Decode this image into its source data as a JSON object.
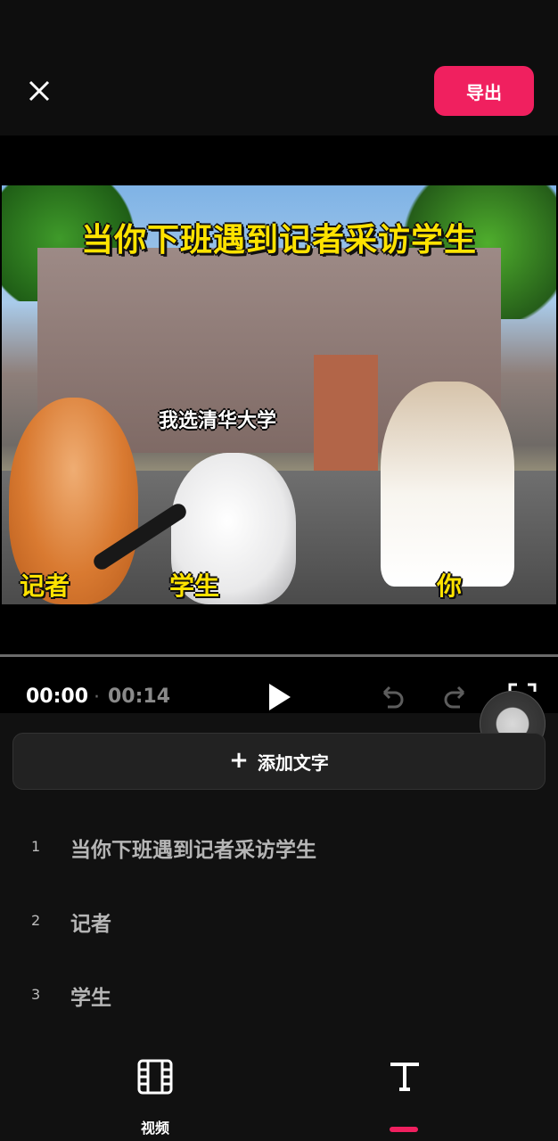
{
  "header": {
    "close_icon": "close-icon",
    "export_label": "导出",
    "accent_color": "#f0205f"
  },
  "preview": {
    "headline": "当你下班遇到记者采访学生",
    "subline": "我选清华大学",
    "labels": {
      "reporter": "记者",
      "student": "学生",
      "you": "你"
    }
  },
  "playback": {
    "current_time": "00:00",
    "total_time": "00:14",
    "play_icon": "play-icon",
    "undo_icon": "undo-icon",
    "redo_icon": "redo-icon",
    "fullscreen_icon": "fullscreen-icon"
  },
  "editor": {
    "add_text_label": "添加文字",
    "text_items": [
      {
        "index": "1",
        "text": "当你下班遇到记者采访学生"
      },
      {
        "index": "2",
        "text": "记者"
      },
      {
        "index": "3",
        "text": "学生"
      }
    ]
  },
  "bottom_nav": {
    "video_label": "视频",
    "video_icon": "film-icon",
    "text_icon": "text-icon"
  }
}
